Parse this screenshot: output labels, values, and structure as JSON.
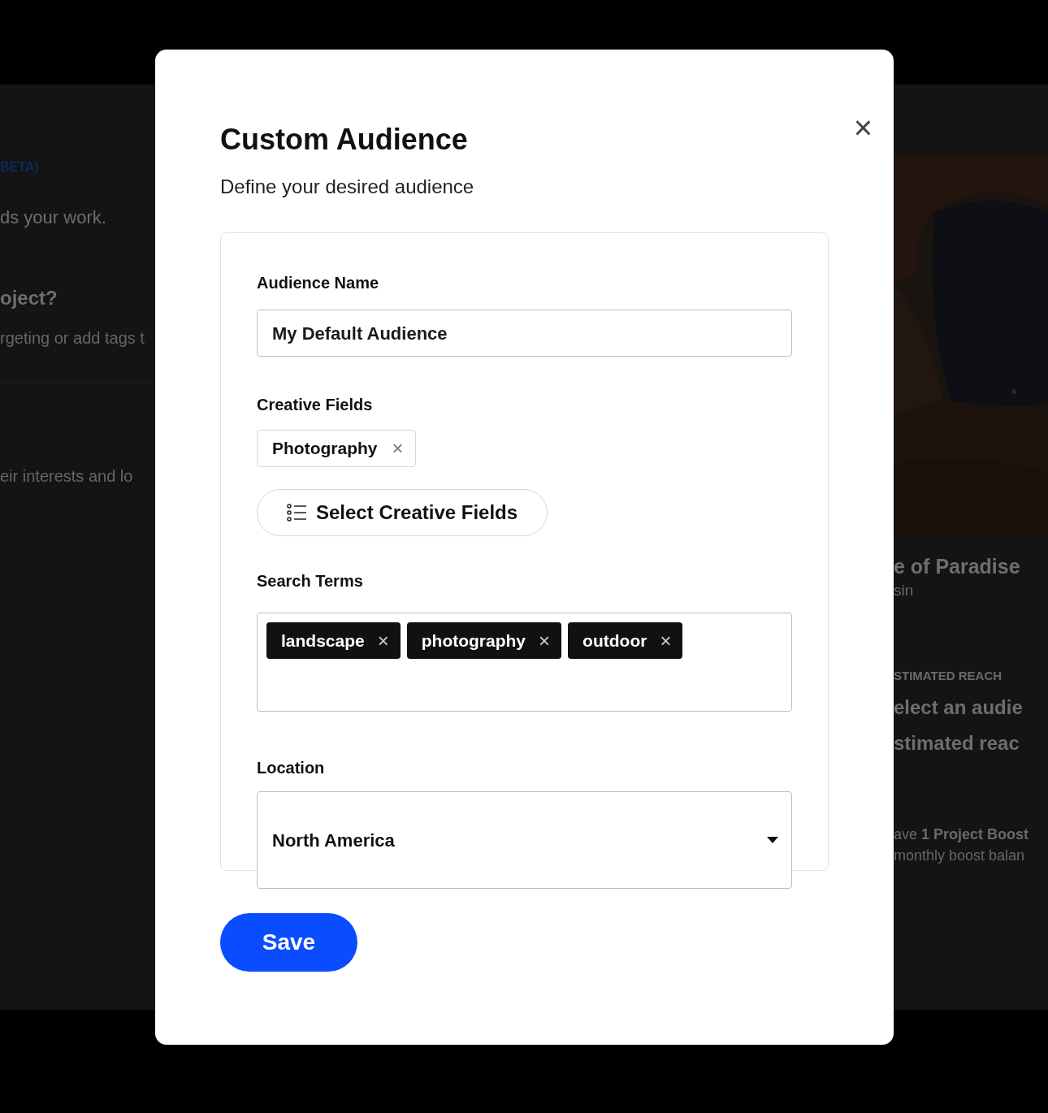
{
  "background": {
    "left": [
      {
        "kind": "badge",
        "text": "BETA)"
      },
      {
        "kind": "body",
        "text": "ds your work."
      },
      {
        "kind": "heading",
        "text": "oject?"
      },
      {
        "kind": "muted",
        "text": "rgeting or add tags t"
      },
      {
        "kind": "divider"
      },
      {
        "kind": "muted",
        "text": "eir interests and lo"
      }
    ],
    "right": [
      {
        "kind": "picture"
      },
      {
        "kind": "heading",
        "text": "e of Paradise"
      },
      {
        "kind": "body",
        "text": "sin"
      },
      {
        "kind": "caption",
        "text": "STIMATED REACH"
      },
      {
        "kind": "big",
        "text": "elect an audie"
      },
      {
        "kind": "big",
        "text": "stimated reac"
      },
      {
        "kind": "rich",
        "text": "ave **1 Project Boost**"
      },
      {
        "kind": "muted",
        "text": "monthly boost balan"
      }
    ]
  },
  "modal": {
    "close": "×",
    "title": "Custom Audience",
    "subtitle": "Define your desired audience",
    "audience_name": {
      "label": "Audience Name",
      "value": "My Default Audience"
    },
    "creative_fields": {
      "label": "Creative Fields",
      "chips": [
        {
          "label": "Photography",
          "remove": "×"
        }
      ],
      "button": "Select Creative Fields"
    },
    "search_terms": {
      "label": "Search Terms",
      "tags": [
        {
          "label": "landscape",
          "remove": "×"
        },
        {
          "label": "photography",
          "remove": "×"
        },
        {
          "label": "outdoor",
          "remove": "×"
        }
      ]
    },
    "location": {
      "label": "Location",
      "value": "North America"
    },
    "save": "Save"
  }
}
